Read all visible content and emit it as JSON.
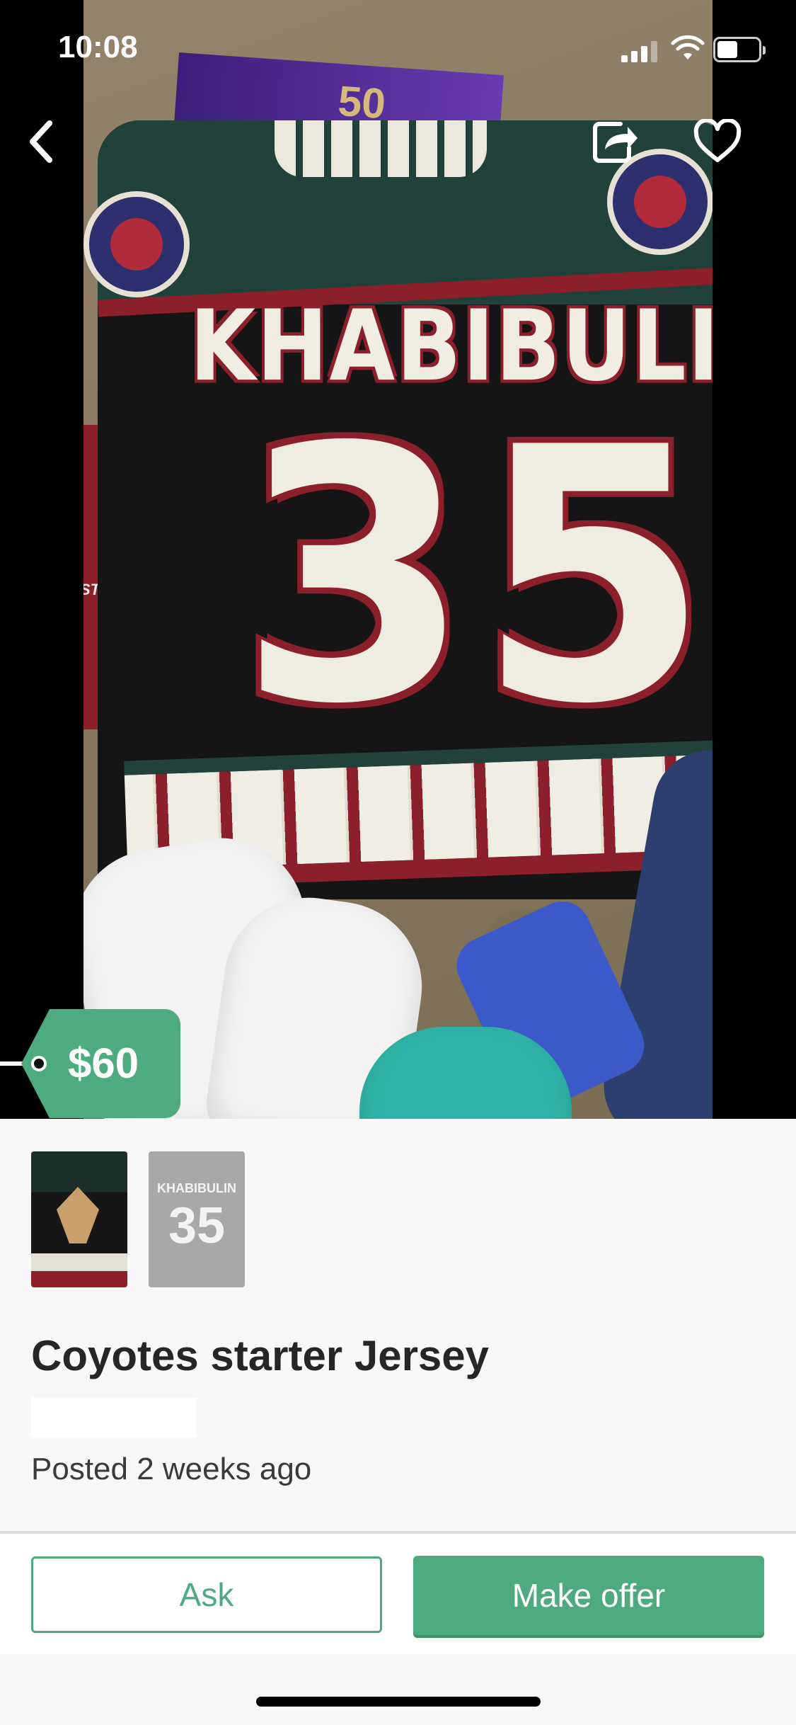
{
  "status_bar": {
    "time": "10:08",
    "battery_level": 0.5
  },
  "photo": {
    "jersey_name": "KHABIBULIN",
    "jersey_number": "35",
    "poster_text": "50",
    "brand_text": "STARTER"
  },
  "price": {
    "label": "$60"
  },
  "thumbnails": [
    {
      "name": "",
      "number": ""
    },
    {
      "name": "KHABIBULIN",
      "number": "35"
    }
  ],
  "listing": {
    "title": "Coyotes starter Jersey",
    "posted": "Posted 2 weeks ago"
  },
  "actions": {
    "ask_label": "Ask",
    "offer_label": "Make offer"
  },
  "colors": {
    "accent": "#4dab7f",
    "title_text": "#262626"
  },
  "icons": {
    "back": "chevron-left-icon",
    "share": "share-icon",
    "favorite": "heart-outline-icon"
  }
}
